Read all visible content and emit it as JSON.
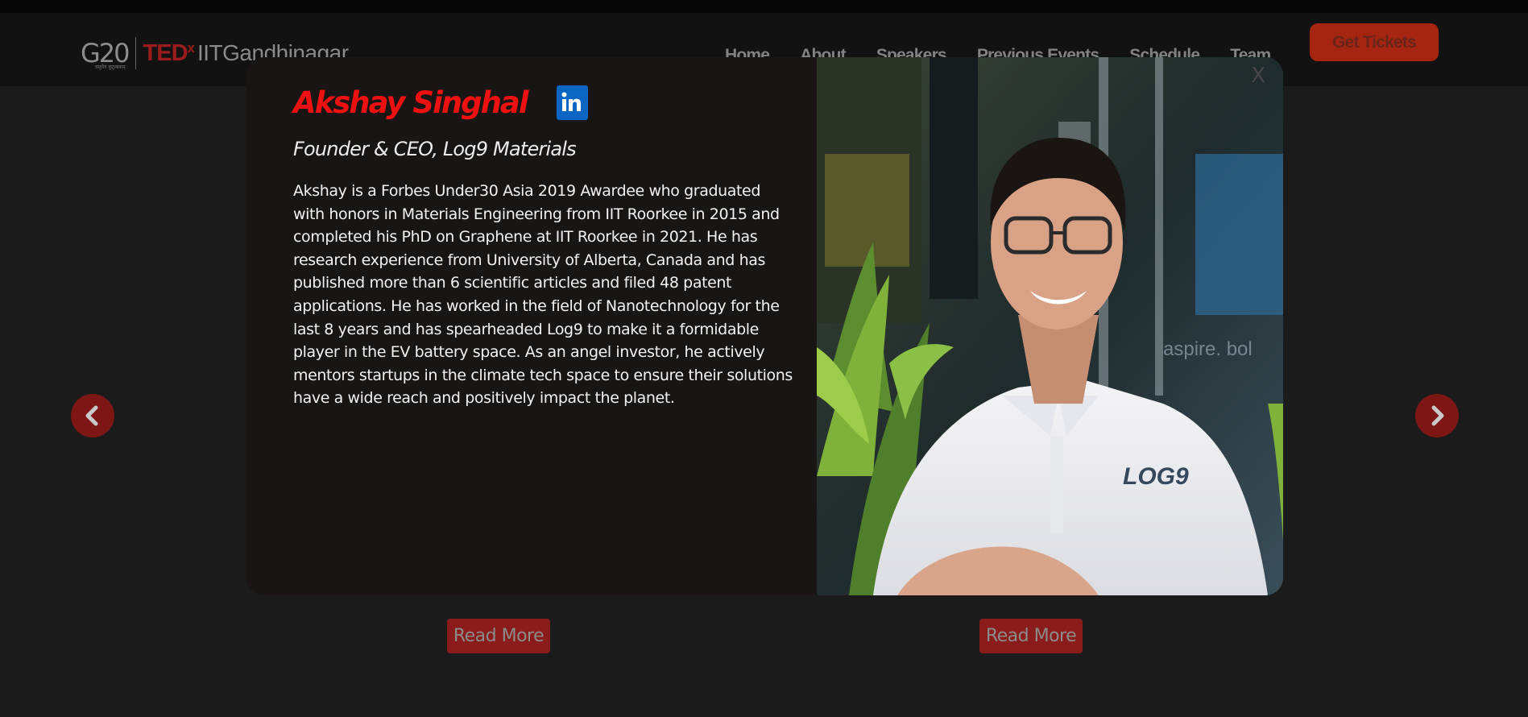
{
  "header": {
    "logo_g20": "G20",
    "logo_g20_sub": "वसुधैव कुटुम्बकम्",
    "logo_tedx": "TED",
    "logo_tedx_x": "x",
    "logo_name": "IITGandhinagar",
    "nav": [
      "Home",
      "About",
      "Speakers",
      "Previous Events",
      "Schedule",
      "Team"
    ],
    "cta": "Get Tickets"
  },
  "modal": {
    "name": "Akshay Singhal",
    "role": "Founder & CEO, Log9 Materials",
    "bio": "Akshay is a Forbes Under30 Asia 2019 Awardee who graduated with honors in Materials Engineering from IIT Roorkee in 2015 and completed his PhD on Graphene at IIT Roorkee in 2021. He has research experience from University of Alberta, Canada and has published more than 6 scientific articles and filed 48 patent applications. He has worked in the field of Nanotechnology for the last 8 years and has spearheaded Log9 to make it a formidable player in the EV battery space. As an angel investor, he actively mentors startups in the climate tech space to ensure their solutions have a wide reach and positively impact the planet.",
    "close": "X",
    "linkedin_icon": "in",
    "photo_text_shirt": "LOG9",
    "photo_text_sign": "aspire. bol"
  },
  "cards": {
    "read_more_left": "Read More",
    "read_more_right": "Read More"
  },
  "icons": {
    "prev": "chevron-left-icon",
    "next": "chevron-right-icon"
  },
  "colors": {
    "accent": "#ee1111",
    "button": "#a52511",
    "linkedin": "#0a66c2"
  }
}
